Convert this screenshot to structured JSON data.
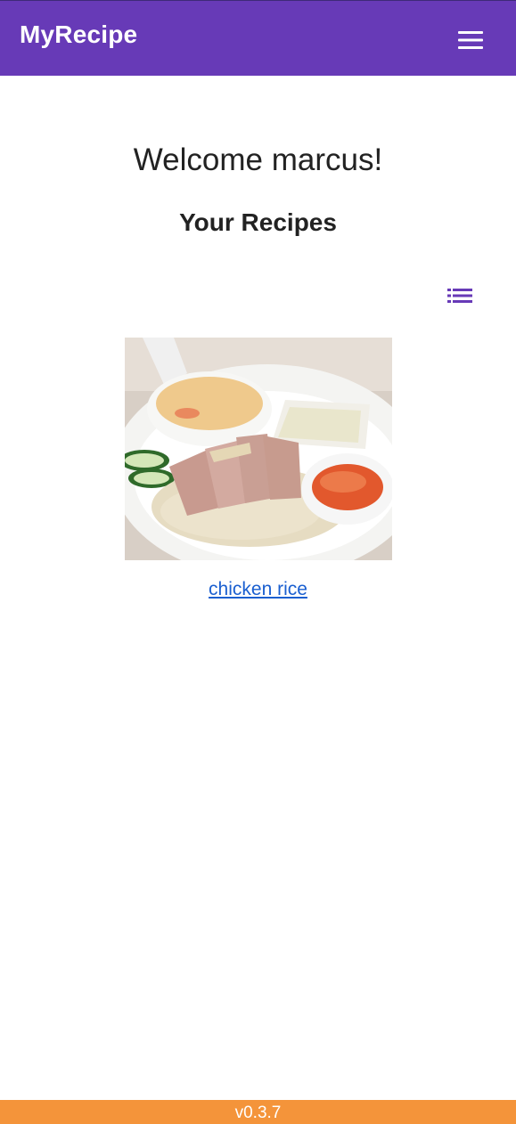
{
  "app_bar": {
    "title": "MyRecipe",
    "menu_icon": "hamburger-menu-icon",
    "background_color": "#673ab7"
  },
  "main": {
    "welcome_text": "Welcome marcus!",
    "section_title": "Your Recipes",
    "view_toggle_icon": "list-view-icon",
    "accent_color": "#673ab7",
    "recipes": [
      {
        "name": "chicken rice",
        "image_alt": "chicken rice"
      }
    ]
  },
  "footer": {
    "version": "v0.3.7",
    "background_color": "#f4943a"
  }
}
